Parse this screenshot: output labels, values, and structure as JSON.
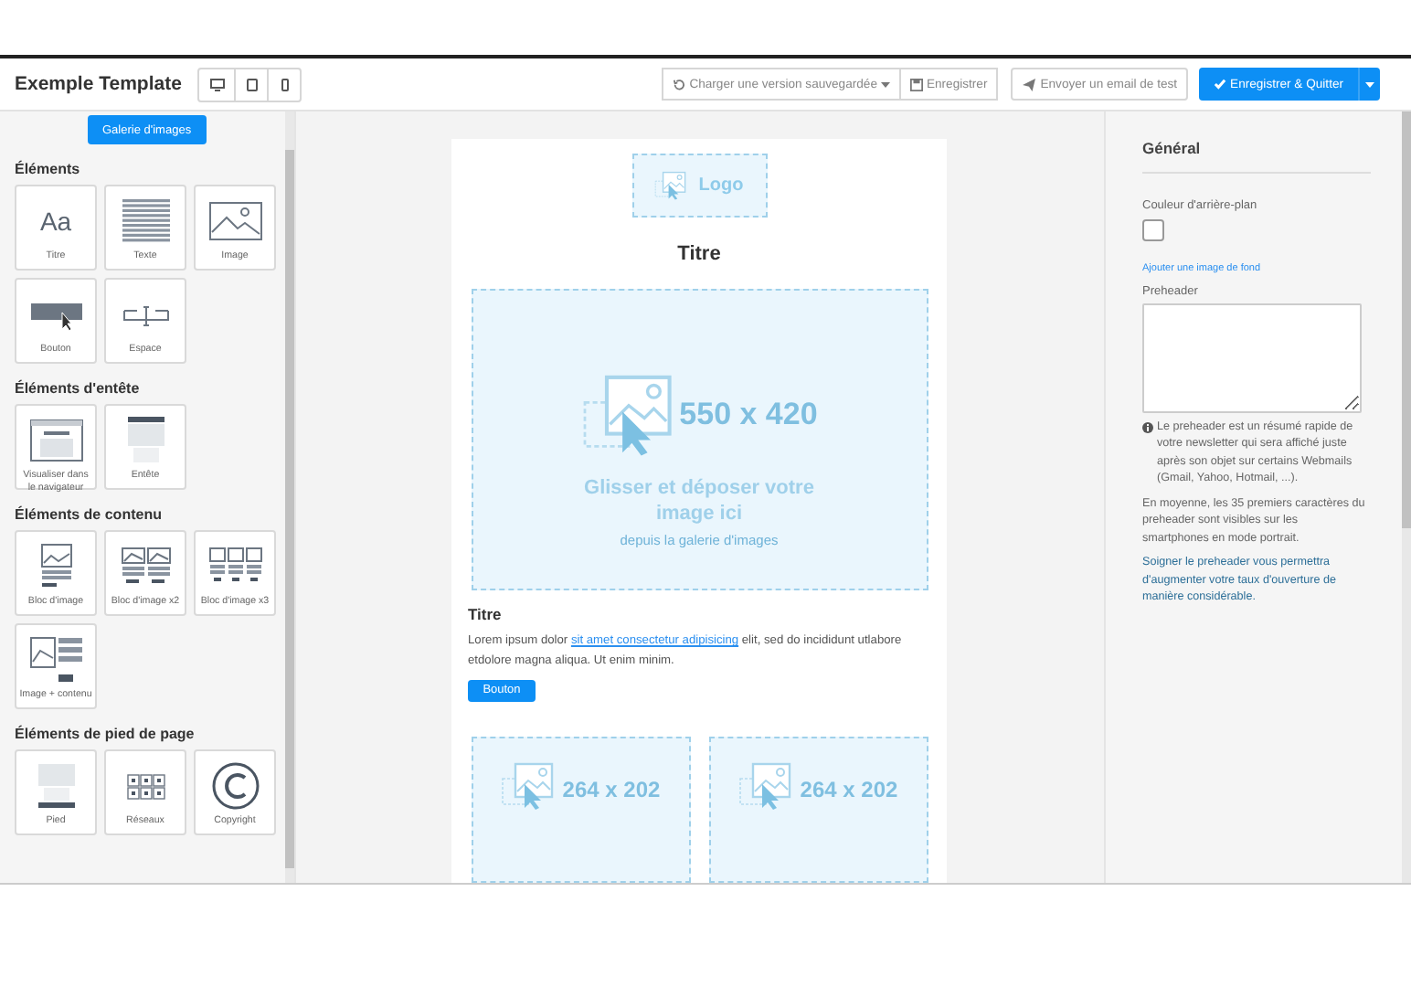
{
  "title": "Exemple Template",
  "toolbar": {
    "load_version": "Charger une version sauvegardée",
    "save": "Enregistrer",
    "send_test": "Envoyer un email de test",
    "save_quit": "Enregistrer & Quitter"
  },
  "sidebar": {
    "gallery_button": "Galerie d'images",
    "sections": [
      {
        "title": "Éléments",
        "items": [
          {
            "label": "Titre",
            "kind": "title",
            "glyph": "Aa"
          },
          {
            "label": "Texte",
            "kind": "text"
          },
          {
            "label": "Image",
            "kind": "image"
          },
          {
            "label": "Bouton",
            "kind": "button"
          },
          {
            "label": "Espace",
            "kind": "space"
          }
        ]
      },
      {
        "title": "Éléments d'entête",
        "items": [
          {
            "label": "Visualiser dans le navigateur",
            "kind": "browser"
          },
          {
            "label": "Entête",
            "kind": "header"
          }
        ]
      },
      {
        "title": "Éléments de contenu",
        "items": [
          {
            "label": "Bloc d'image",
            "kind": "image_block"
          },
          {
            "label": "Bloc d'image x2",
            "kind": "image_block2"
          },
          {
            "label": "Bloc d'image x3",
            "kind": "image_block3"
          },
          {
            "label": "Image + contenu",
            "kind": "image_text"
          }
        ]
      },
      {
        "title": "Éléments de pied de page",
        "items": [
          {
            "label": "Pied",
            "kind": "footer"
          },
          {
            "label": "Réseaux",
            "kind": "social"
          },
          {
            "label": "Copyright",
            "kind": "copyright"
          }
        ]
      }
    ]
  },
  "email": {
    "logo": "Logo",
    "title": "Titre",
    "hero": {
      "size": "550 x 420",
      "drop_text": "Glisser et déposer votre image ici",
      "drop_sub": "depuis la galerie d'images"
    },
    "block": {
      "title": "Titre",
      "text_before": "Lorem ipsum dolor ",
      "link": "sit amet consectetur adipisicing",
      "text_after": " elit, sed do incididunt utlabore etdolore magna aliqua. Ut enim minim.",
      "button": "Bouton"
    },
    "images": [
      {
        "size": "264 x 202"
      },
      {
        "size": "264 x 202"
      }
    ]
  },
  "panel": {
    "heading": "Général",
    "bg_color_label": "Couleur d'arrière-plan",
    "bg_image_link": "Ajouter une image de fond",
    "preheader_label": "Preheader",
    "notes": [
      {
        "kind": "info",
        "text": "Le preheader est un résumé rapide de votre newsletter qui sera affiché juste après son objet sur certains Webmails (Gmail, Yahoo, Hotmail, ...)."
      },
      {
        "kind": "plain",
        "text": "En moyenne, les 35 premiers caractères du preheader sont visibles sur les smartphones en mode portrait."
      },
      {
        "kind": "tip",
        "text": "Soigner le preheader vous permettra d'augmenter votre taux d'ouverture de manière considérable."
      }
    ]
  }
}
